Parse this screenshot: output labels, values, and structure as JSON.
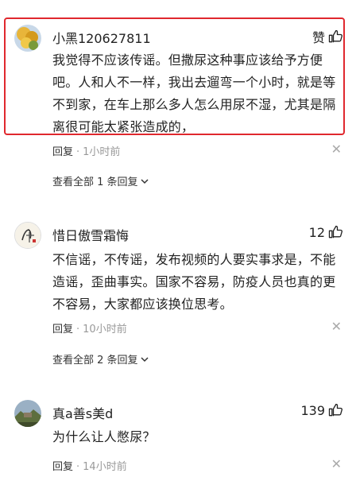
{
  "comments": [
    {
      "username": "小黑120627811",
      "like_label": "赞",
      "text": "我觉得不应该传谣。但撒尿这种事应该给予方便吧。人和人不一样，我出去遛弯一个小时，就是等不到家，在车上那么多人怎么用尿不湿，尤其是隔离很可能太紧张造成的，",
      "reply_label": "回复",
      "time": "1小时前",
      "view_all": "查看全部 1 条回复",
      "highlighted": true
    },
    {
      "username": "惜日傲雪霜悔",
      "like_count": "12",
      "text": "不信谣，不传谣，发布视频的人要实事求是，不能造谣，歪曲事实。国家不容易，防疫人员也真的更不容易，大家都应该换位思考。",
      "reply_label": "回复",
      "time": "10小时前",
      "view_all": "查看全部 2 条回复"
    },
    {
      "username": "真a善s美d",
      "like_count": "139",
      "text": "为什么让人憋尿？",
      "reply_label": "回复",
      "time": "14小时前"
    }
  ],
  "colors": {
    "highlight_border": "#e0282e",
    "meta": "#999999"
  },
  "icons": {
    "like": "thumbs-up-icon",
    "close": "close-icon",
    "expand": "chevron-down-icon"
  }
}
